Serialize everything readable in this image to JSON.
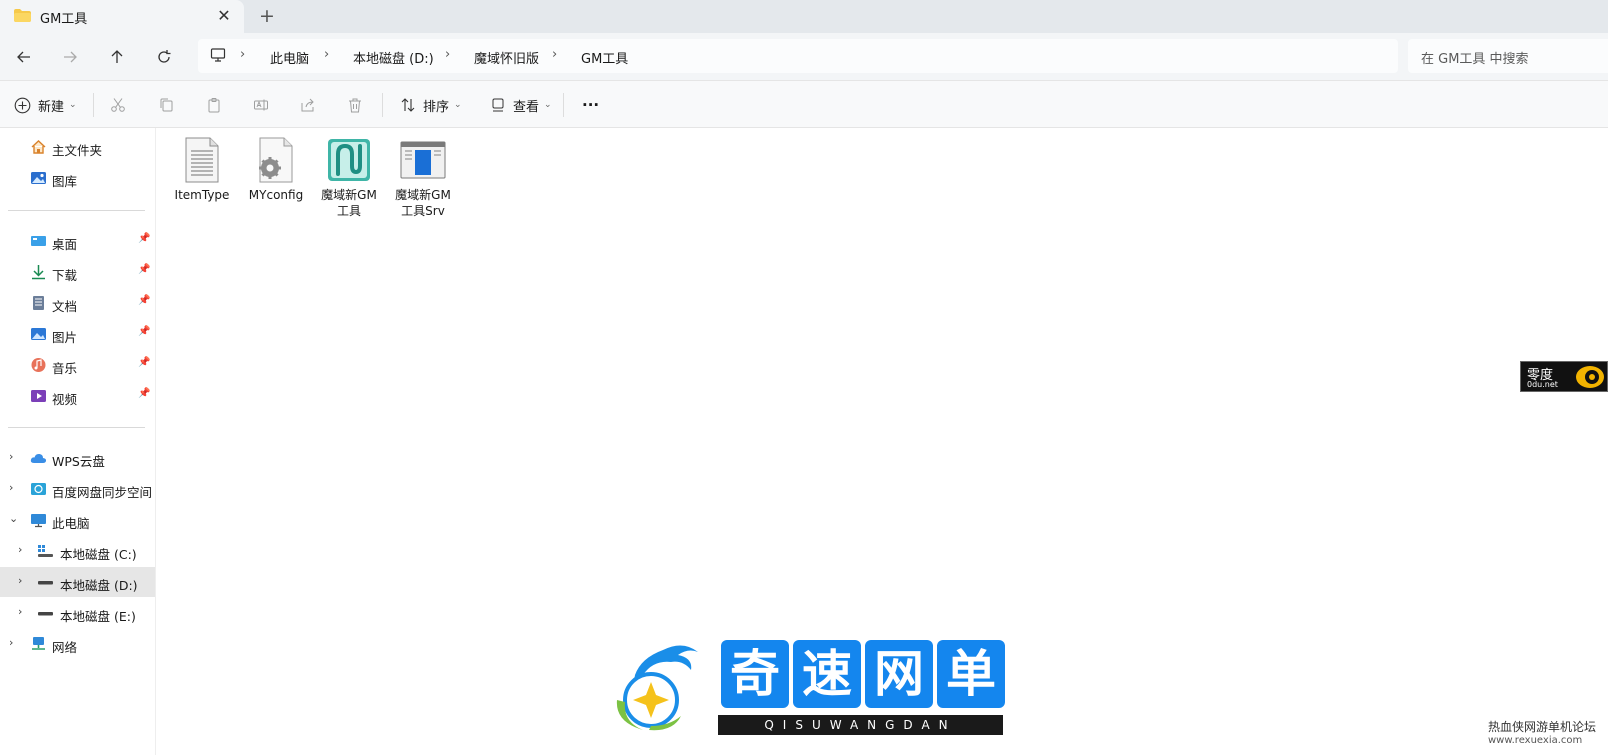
{
  "tab": {
    "title": "GM工具",
    "close": "✕",
    "new_tab": "+"
  },
  "breadcrumb": [
    "此电脑",
    "本地磁盘 (D:)",
    "魔域怀旧版",
    "GM工具"
  ],
  "search": {
    "placeholder": "在 GM工具 中搜索"
  },
  "toolbar": {
    "new_label": "新建",
    "sort_label": "排序",
    "view_label": "查看",
    "more_label": "···"
  },
  "sidebar": {
    "quick": [
      {
        "label": "主文件夹"
      },
      {
        "label": "图库"
      }
    ],
    "pinned": [
      {
        "label": "桌面"
      },
      {
        "label": "下载"
      },
      {
        "label": "文档"
      },
      {
        "label": "图片"
      },
      {
        "label": "音乐"
      },
      {
        "label": "视频"
      }
    ],
    "tree": [
      {
        "label": "WPS云盘"
      },
      {
        "label": "百度网盘同步空间"
      },
      {
        "label": "此电脑"
      },
      {
        "label": "本地磁盘 (C:)"
      },
      {
        "label": "本地磁盘 (D:)"
      },
      {
        "label": "本地磁盘 (E:)"
      },
      {
        "label": "网络"
      }
    ]
  },
  "files": [
    {
      "name_line1": "ItemType",
      "name_line2": ""
    },
    {
      "name_line1": "MYconfig",
      "name_line2": ""
    },
    {
      "name_line1": "魔域新GM",
      "name_line2": "工具"
    },
    {
      "name_line1": "魔域新GM",
      "name_line2": "工具Srv"
    }
  ],
  "watermarks": {
    "badge_title": "零度",
    "badge_url": "0du.net",
    "brand_chars": [
      "奇",
      "速",
      "网",
      "单"
    ],
    "brand_pinyin": "QISUWANGDAN",
    "corner_title": "热血侠网游单机论坛",
    "corner_url": "www.rexuexia.com"
  },
  "colors": {
    "accent": "#1486ee",
    "selected": "#e6e6e6",
    "folder": "#f6c94a"
  }
}
